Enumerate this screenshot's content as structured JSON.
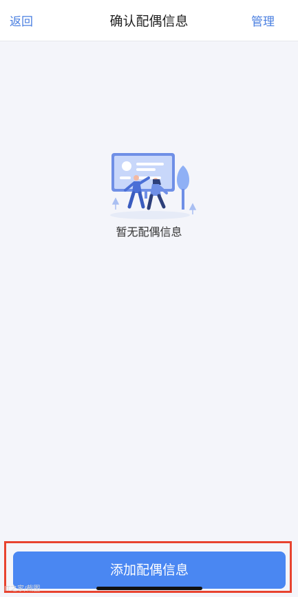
{
  "nav": {
    "back_label": "返回",
    "title": "确认配偶信息",
    "manage_label": "管理"
  },
  "empty_state": {
    "message": "暂无配偶信息"
  },
  "footer": {
    "add_button_label": "添加配偶信息",
    "watermark": "IT之家/截图"
  },
  "colors": {
    "accent": "#4a87f2",
    "highlight": "#e8432f",
    "background": "#f4f5fa"
  }
}
